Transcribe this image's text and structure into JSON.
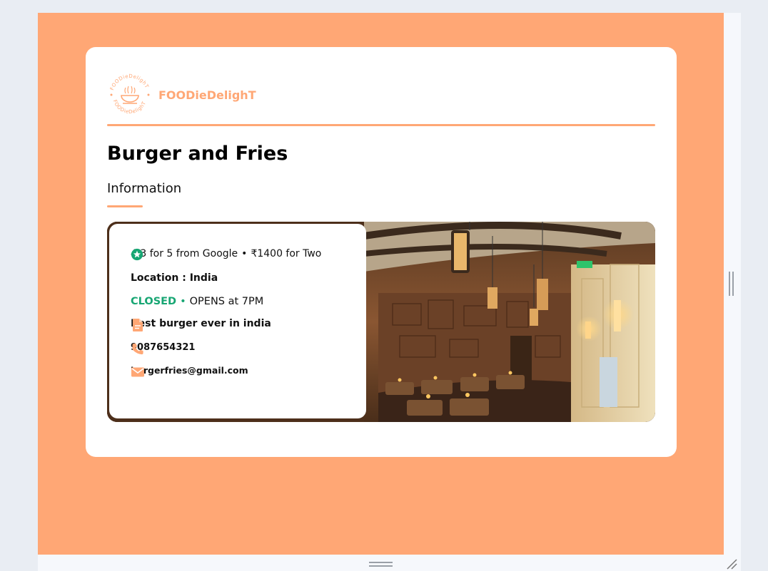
{
  "brand": {
    "name": "FOODieDelighT",
    "logo_ring_text": "FOODieDelighT",
    "logo_ring_text_bottom": "FOODieDelighT"
  },
  "restaurant": {
    "name": "Burger and Fries",
    "section_title": "Information",
    "rating_text": "4.3 for 5 from Google",
    "separator": "•",
    "price_text": "₹1400 for Two",
    "location_text": "Location : India",
    "status": "CLOSED",
    "opens_text": "OPENS at 7PM",
    "description": "Best burger ever in india",
    "phone": "9087654321",
    "email": "burgerfries@gmail.com"
  },
  "icons": {
    "rating": "star-icon",
    "description": "document-icon",
    "phone": "phone-icon",
    "email": "mail-icon"
  },
  "colors": {
    "accent": "#ffa775",
    "status_closed": "#17a673",
    "star": "#17a673"
  }
}
